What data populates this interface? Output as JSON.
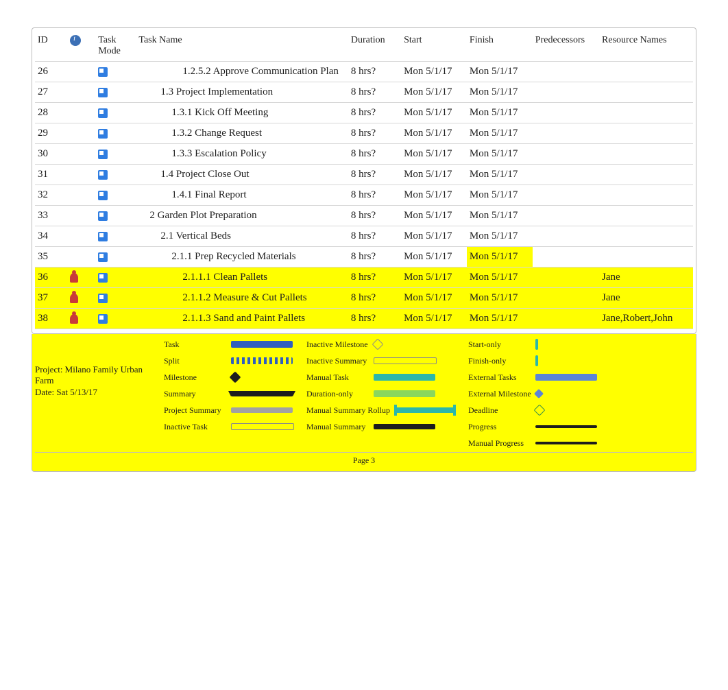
{
  "meta": {
    "project_title_line1": "Project: Milano Family Urban Farm",
    "project_title_line2": "Date: Sat 5/13/17",
    "page_label": "Page 3"
  },
  "columns": {
    "id": "ID",
    "indicator": "",
    "task_mode": "Task Mode",
    "task_name": "Task Name",
    "duration": "Duration",
    "start": "Start",
    "finish": "Finish",
    "predecessors": "Predecessors",
    "resource_names": "Resource Names"
  },
  "rows": [
    {
      "id": "26",
      "icon": "",
      "name": "1.2.5.2 Approve Communication Plan",
      "indent": 4,
      "duration": "8 hrs?",
      "start": "Mon 5/1/17",
      "finish": "Mon 5/1/17",
      "pred": "",
      "res": "",
      "hl_row": false,
      "finish_hl": false
    },
    {
      "id": "27",
      "icon": "",
      "name": "1.3 Project Implementation",
      "indent": 2,
      "duration": "8 hrs?",
      "start": "Mon 5/1/17",
      "finish": "Mon 5/1/17",
      "pred": "",
      "res": "",
      "hl_row": false,
      "finish_hl": false
    },
    {
      "id": "28",
      "icon": "",
      "name": "1.3.1 Kick Off Meeting",
      "indent": 3,
      "duration": "8 hrs?",
      "start": "Mon 5/1/17",
      "finish": "Mon 5/1/17",
      "pred": "",
      "res": "",
      "hl_row": false,
      "finish_hl": false
    },
    {
      "id": "29",
      "icon": "",
      "name": "1.3.2 Change Request",
      "indent": 3,
      "duration": "8 hrs?",
      "start": "Mon 5/1/17",
      "finish": "Mon 5/1/17",
      "pred": "",
      "res": "",
      "hl_row": false,
      "finish_hl": false
    },
    {
      "id": "30",
      "icon": "",
      "name": "1.3.3 Escalation Policy",
      "indent": 3,
      "duration": "8 hrs?",
      "start": "Mon 5/1/17",
      "finish": "Mon 5/1/17",
      "pred": "",
      "res": "",
      "hl_row": false,
      "finish_hl": false
    },
    {
      "id": "31",
      "icon": "",
      "name": "1.4 Project Close Out",
      "indent": 2,
      "duration": "8 hrs?",
      "start": "Mon 5/1/17",
      "finish": "Mon 5/1/17",
      "pred": "",
      "res": "",
      "hl_row": false,
      "finish_hl": false
    },
    {
      "id": "32",
      "icon": "",
      "name": "1.4.1 Final Report",
      "indent": 3,
      "duration": "8 hrs?",
      "start": "Mon 5/1/17",
      "finish": "Mon 5/1/17",
      "pred": "",
      "res": "",
      "hl_row": false,
      "finish_hl": false
    },
    {
      "id": "33",
      "icon": "",
      "name": "2 Garden Plot Preparation",
      "indent": 1,
      "duration": "8 hrs?",
      "start": "Mon 5/1/17",
      "finish": "Mon 5/1/17",
      "pred": "",
      "res": "",
      "hl_row": false,
      "finish_hl": false
    },
    {
      "id": "34",
      "icon": "",
      "name": "2.1 Vertical Beds",
      "indent": 2,
      "duration": "8 hrs?",
      "start": "Mon 5/1/17",
      "finish": "Mon 5/1/17",
      "pred": "",
      "res": "",
      "hl_row": false,
      "finish_hl": false
    },
    {
      "id": "35",
      "icon": "",
      "name": "2.1.1 Prep Recycled Materials",
      "indent": 3,
      "duration": "8 hrs?",
      "start": "Mon 5/1/17",
      "finish": "Mon 5/1/17",
      "pred": "",
      "res": "",
      "hl_row": false,
      "finish_hl": true
    },
    {
      "id": "36",
      "icon": "person",
      "name": "2.1.1.1 Clean Pallets",
      "indent": 4,
      "duration": "8 hrs?",
      "start": "Mon 5/1/17",
      "finish": "Mon 5/1/17",
      "pred": "",
      "res": "Jane",
      "hl_row": true,
      "finish_hl": false
    },
    {
      "id": "37",
      "icon": "person",
      "name": "2.1.1.2 Measure & Cut Pallets",
      "indent": 4,
      "duration": "8 hrs?",
      "start": "Mon 5/1/17",
      "finish": "Mon 5/1/17",
      "pred": "",
      "res": "Jane",
      "hl_row": true,
      "finish_hl": false
    },
    {
      "id": "38",
      "icon": "person",
      "name": "2.1.1.3 Sand and Paint Pallets",
      "indent": 4,
      "duration": "8 hrs?",
      "start": "Mon 5/1/17",
      "finish": "Mon 5/1/17",
      "pred": "",
      "res": "Jane,Robert,John",
      "hl_row": true,
      "finish_hl": false
    }
  ],
  "legend": {
    "highlighted": true,
    "cols": [
      [
        {
          "label": "Task",
          "bar": "bar-task"
        },
        {
          "label": "Split",
          "bar": "bar-split"
        },
        {
          "label": "Milestone",
          "bar": "bar-milestone"
        },
        {
          "label": "Summary",
          "bar": "bar-summary"
        },
        {
          "label": "Project Summary",
          "bar": "bar-psummary"
        },
        {
          "label": "Inactive Task",
          "bar": "bar-inactive-task"
        }
      ],
      [
        {
          "label": "Inactive Milestone",
          "bar": "bar-inactive-milestone"
        },
        {
          "label": "Inactive Summary",
          "bar": "bar-inactive-summary"
        },
        {
          "label": "Manual Task",
          "bar": "bar-manual-task"
        },
        {
          "label": "Duration-only",
          "bar": "bar-duration-only"
        },
        {
          "label": "Manual Summary Rollup",
          "bar": "bar-msr"
        },
        {
          "label": "Manual Summary",
          "bar": "bar-manual-summary"
        }
      ],
      [
        {
          "label": "Start-only",
          "bar": "bar-start-only"
        },
        {
          "label": "Finish-only",
          "bar": "bar-finish-only"
        },
        {
          "label": "External Tasks",
          "bar": "bar-external"
        },
        {
          "label": "External Milestone",
          "bar": "bar-ext-mile"
        },
        {
          "label": "Deadline",
          "bar": "bar-deadline"
        },
        {
          "label": "Progress",
          "bar": "bar-progress"
        },
        {
          "label": "Manual Progress",
          "bar": "bar-manual-progress"
        }
      ]
    ]
  }
}
